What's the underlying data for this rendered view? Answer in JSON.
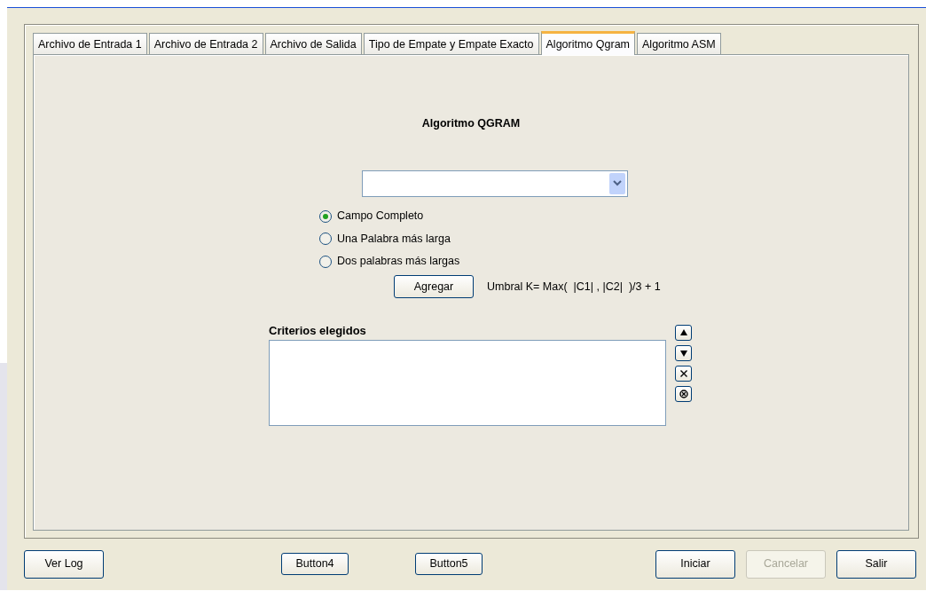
{
  "tabs": [
    {
      "label": "Archivo de Entrada 1",
      "selected": false
    },
    {
      "label": "Archivo de Entrada 2",
      "selected": false
    },
    {
      "label": "Archivo de Salida",
      "selected": false
    },
    {
      "label": "Tipo de Empate y Empate Exacto",
      "selected": false
    },
    {
      "label": "Algoritmo Qgram",
      "selected": true
    },
    {
      "label": "Algoritmo ASM",
      "selected": false
    }
  ],
  "panel": {
    "title": "Algoritmo QGRAM",
    "options": [
      {
        "label": "Campo Completo",
        "selected": true
      },
      {
        "label": "Una Palabra más larga",
        "selected": false
      },
      {
        "label": "Dos palabras más largas",
        "selected": false
      }
    ],
    "add_button": "Agregar",
    "formula": "Umbral K= Max(  |C1| , |C2|  )/3 + 1",
    "list_label": "Criterios elegidos",
    "side_buttons": [
      {
        "kind": "up"
      },
      {
        "kind": "down"
      },
      {
        "kind": "remove"
      },
      {
        "kind": "clear"
      }
    ]
  },
  "buttons": [
    {
      "label": "Ver Log",
      "disabled": false,
      "kind": "wide"
    },
    {
      "label": "Button4",
      "disabled": false,
      "kind": "small"
    },
    {
      "label": "Button5",
      "disabled": false,
      "kind": "small"
    },
    {
      "label": "Iniciar",
      "disabled": false,
      "kind": "wide"
    },
    {
      "label": "Cancelar",
      "disabled": true,
      "kind": "wide"
    },
    {
      "label": "Salir",
      "disabled": false,
      "kind": "wide"
    }
  ]
}
